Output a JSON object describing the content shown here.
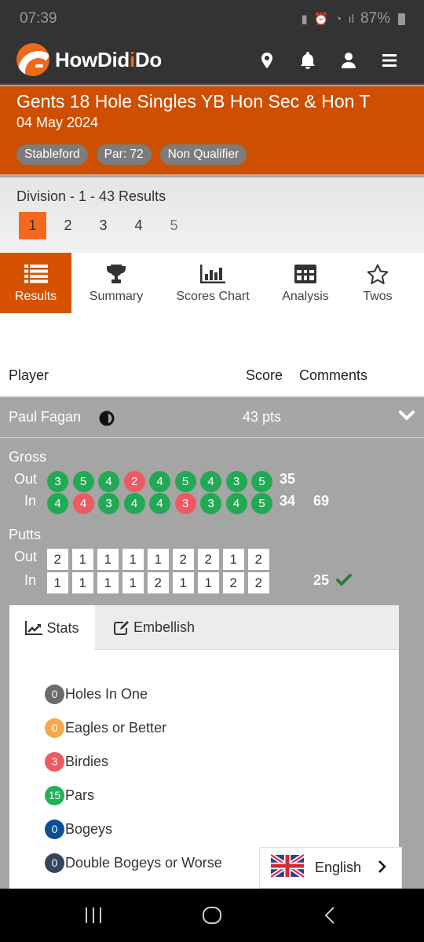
{
  "status_bar": {
    "time": "07:39",
    "battery": "87%"
  },
  "app": {
    "name_part1": "HowDid",
    "name_i": "i",
    "name_part2": "Do"
  },
  "header_icons": [
    "map-marker-icon",
    "bell-icon",
    "user-icon",
    "menu-icon"
  ],
  "event": {
    "title": "Gents 18 Hole Singles YB Hon Sec & Hon T",
    "date": "04 May 2024",
    "tags": [
      "Stableford",
      "Par: 72",
      "Non Qualifier"
    ]
  },
  "division": {
    "title": "Division - 1 - 43 Results",
    "pages": [
      "1",
      "2",
      "3",
      "4",
      "5"
    ],
    "active_page": "1"
  },
  "tabs": [
    {
      "label": "Results",
      "icon": "list-icon",
      "active": true
    },
    {
      "label": "Summary",
      "icon": "trophy-icon",
      "active": false
    },
    {
      "label": "Scores Chart",
      "icon": "bar-chart-icon",
      "active": false
    },
    {
      "label": "Analysis",
      "icon": "table-icon",
      "active": false
    },
    {
      "label": "Twos",
      "icon": "star-icon",
      "active": false
    }
  ],
  "table_header": {
    "player": "Player",
    "score": "Score",
    "comments": "Comments"
  },
  "player": {
    "name": "Paul Fagan",
    "score": "43 pts",
    "gross": {
      "label": "Gross",
      "out_label": "Out",
      "in_label": "In",
      "out": [
        {
          "v": "3",
          "c": "green"
        },
        {
          "v": "5",
          "c": "green"
        },
        {
          "v": "4",
          "c": "green"
        },
        {
          "v": "2",
          "c": "red"
        },
        {
          "v": "4",
          "c": "green"
        },
        {
          "v": "5",
          "c": "green"
        },
        {
          "v": "4",
          "c": "green"
        },
        {
          "v": "3",
          "c": "green"
        },
        {
          "v": "5",
          "c": "green"
        }
      ],
      "in": [
        {
          "v": "4",
          "c": "green"
        },
        {
          "v": "4",
          "c": "red"
        },
        {
          "v": "3",
          "c": "green"
        },
        {
          "v": "4",
          "c": "green"
        },
        {
          "v": "4",
          "c": "green"
        },
        {
          "v": "3",
          "c": "red"
        },
        {
          "v": "3",
          "c": "green"
        },
        {
          "v": "4",
          "c": "green"
        },
        {
          "v": "5",
          "c": "green"
        }
      ],
      "out_total": "35",
      "in_total": "34",
      "total": "69"
    },
    "putts": {
      "label": "Putts",
      "out_label": "Out",
      "in_label": "In",
      "out": [
        "2",
        "1",
        "1",
        "1",
        "1",
        "2",
        "2",
        "1",
        "2"
      ],
      "in": [
        "1",
        "1",
        "1",
        "1",
        "2",
        "1",
        "1",
        "2",
        "2"
      ],
      "total": "25"
    }
  },
  "panel": {
    "tabs": [
      {
        "label": "Stats",
        "icon": "line-chart-icon",
        "active": true
      },
      {
        "label": "Embellish",
        "icon": "edit-icon",
        "active": false
      }
    ],
    "stats": [
      {
        "count": "0",
        "label": "Holes In One",
        "color": "#6b6b6b"
      },
      {
        "count": "0",
        "label": "Eagles or Better",
        "color": "#f5a94a"
      },
      {
        "count": "3",
        "label": "Birdies",
        "color": "#ef5a62"
      },
      {
        "count": "15",
        "label": "Pars",
        "color": "#22b15a"
      },
      {
        "count": "0",
        "label": "Bogeys",
        "color": "#0b4f96"
      },
      {
        "count": "0",
        "label": "Double Bogeys or Worse",
        "color": "#34465e"
      }
    ]
  },
  "language": {
    "label": "English"
  },
  "colors": {
    "brand_orange": "#cf4f00",
    "active_tab": "#d75200",
    "page_active": "#f36a1e",
    "good_score": "#22a954",
    "bad_score": "#ef5a62"
  }
}
